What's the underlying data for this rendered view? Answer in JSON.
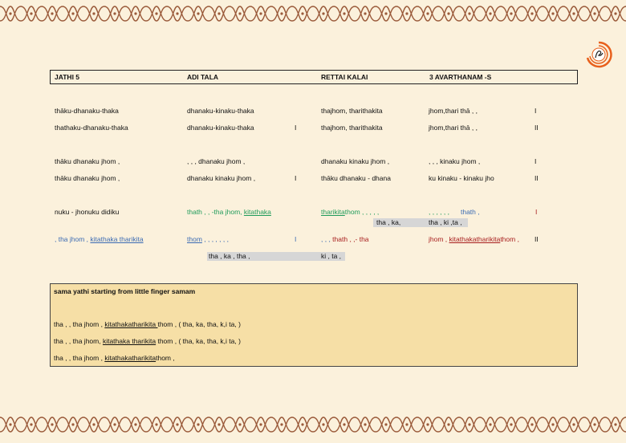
{
  "header": {
    "c1": "JATHI 5",
    "c2": "ADI TALA",
    "c3": "RETTAI KALAI",
    "c4": "3 AVARTHANAM -S"
  },
  "rows": {
    "r1": {
      "a": "thāku-dhanaku-thaka",
      "b": "dhanaku-kinaku-thaka",
      "c": "thajhom, tharithakita",
      "d": "jhom,thari  thā , ,",
      "e": "I"
    },
    "r2": {
      "a": "thathaku-dhanaku-thaka",
      "b": "dhanaku-kinaku-thaka",
      "m": "I",
      "c": "thajhom, tharithakita",
      "d": "jhom,thari  thā , ,",
      "e": "II"
    },
    "r3": {
      "a": "thāku dhanaku jhom ,",
      "b": ", , , dhanaku jhom ,",
      "c": "dhanaku kinaku jhom ,",
      "d": ", , , kinaku jhom ,",
      "e": "I"
    },
    "r4": {
      "a": "thāku dhanaku jhom ,",
      "b": "dhanaku kinaku jhom ,",
      "m": "I",
      "c": "thāku dhanaku -  dhana",
      "d": "ku kinaku -  kinaku jho",
      "e": "II"
    },
    "r5": {
      "a": "nuku  -  jhonuku didiku",
      "b1": "thath , , -tha jhom,  ",
      "b2": "kitathaka",
      "c1": "tharikita",
      "c2": "thom ,   , ,   , ,",
      "d1": ",  ,     , ,     , ,",
      "d2": "thath ,",
      "e": "I",
      "s1": "tha , ka,",
      "s2": "tha , ki ,ta ,"
    },
    "r6": {
      "a1": ", tha jhom ,  ",
      "a2": "kitathaka tharikita",
      "b1": "thom",
      "b2": " ,  , ,   , ,   , ,",
      "m": "I",
      "c1": ", , ,    ",
      "c2": "thath , ,- tha",
      "d1": "jhom , ",
      "d2": "kitathakatharikita",
      "d3": "thom  ,",
      "e": "II",
      "s1": "tha , ka , tha ,",
      "s2": "ki , ta ,"
    }
  },
  "box": {
    "title": "sama yathi starting from  little finger samam",
    "l1a": "tha , , tha jhom , ",
    "l1b": "kitathakatharikita ",
    "l1c": "thom ,    ( tha, ka, tha, k,i ta, )",
    "l2a": "tha , , tha jhom, ",
    "l2b": "kitathaka tharikita",
    "l2c": " thom ,   ( tha, ka, tha, k,i ta, )",
    "l3a": "tha , ,  tha  jhom , ",
    "l3b": "kitathakatharikita",
    "l3c": "thom ,"
  },
  "colors": {
    "border": "#9a5a3a",
    "accent": "#e8601c",
    "green": "#1f9b5a",
    "blue": "#3b6bb3",
    "red": "#a81e1e"
  }
}
